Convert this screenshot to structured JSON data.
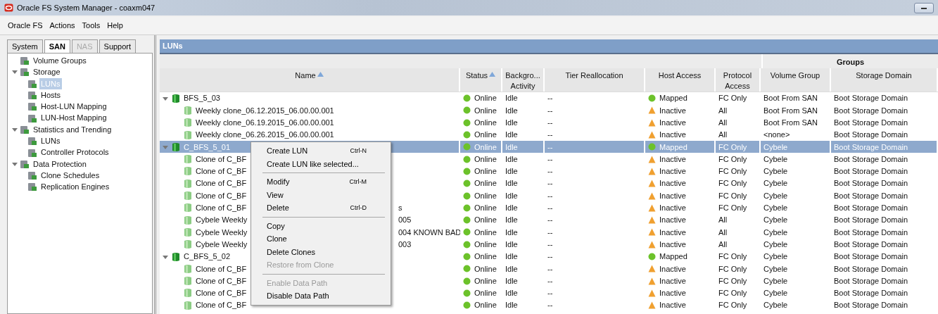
{
  "window": {
    "title": "Oracle FS System Manager - coaxm047"
  },
  "menu_bar": [
    "Oracle FS",
    "Actions",
    "Tools",
    "Help"
  ],
  "nav_tabs": [
    {
      "label": "System",
      "selected": false,
      "disabled": false
    },
    {
      "label": "SAN",
      "selected": true,
      "disabled": false
    },
    {
      "label": "NAS",
      "selected": false,
      "disabled": true
    },
    {
      "label": "Support",
      "selected": false,
      "disabled": false
    }
  ],
  "nav_tree": [
    {
      "label": "Volume Groups",
      "selected": false
    },
    {
      "label": "Storage",
      "expanded": true,
      "selected": false,
      "children": [
        {
          "label": "LUNs",
          "selected": true
        },
        {
          "label": "Hosts",
          "selected": false
        },
        {
          "label": "Host-LUN Mapping",
          "selected": false
        },
        {
          "label": "LUN-Host Mapping",
          "selected": false
        }
      ]
    },
    {
      "label": "Statistics and Trending",
      "expanded": true,
      "selected": false,
      "children": [
        {
          "label": "LUNs",
          "selected": false
        },
        {
          "label": "Controller Protocols",
          "selected": false
        }
      ]
    },
    {
      "label": "Data Protection",
      "expanded": true,
      "selected": false,
      "children": [
        {
          "label": "Clone Schedules",
          "selected": false
        },
        {
          "label": "Replication Engines",
          "selected": false
        }
      ]
    }
  ],
  "panel": {
    "title": "LUNs"
  },
  "table": {
    "group_header": "Groups",
    "columns": [
      {
        "label": "Name",
        "sorted": true
      },
      {
        "label": "Status",
        "sorted": true
      },
      {
        "label": "Backgro... Activity",
        "sorted": false
      },
      {
        "label": "Tier Reallocation",
        "sorted": false
      },
      {
        "label": "Host Access",
        "sorted": false
      },
      {
        "label": "Protocol Access",
        "sorted": false
      },
      {
        "label": "Volume Group",
        "sorted": false
      },
      {
        "label": "Storage Domain",
        "sorted": false
      }
    ],
    "rows": [
      {
        "name": "BFS_5_03",
        "expanded": true,
        "selected": false,
        "status": "Online",
        "activity": "Idle",
        "tier": "--",
        "host_access": "Mapped",
        "warning": false,
        "protocol": "FC Only",
        "volume_group": "Boot From SAN",
        "storage_domain": "Boot Storage Domain",
        "children": [
          {
            "name": "Weekly clone_06.12.2015_06.00.00.001",
            "selected": false,
            "status": "Online",
            "activity": "Idle",
            "tier": "--",
            "host_access": "Inactive",
            "warning": true,
            "protocol": "All",
            "volume_group": "Boot From SAN",
            "storage_domain": "Boot Storage Domain"
          },
          {
            "name": "Weekly clone_06.19.2015_06.00.00.001",
            "selected": false,
            "status": "Online",
            "activity": "Idle",
            "tier": "--",
            "host_access": "Inactive",
            "warning": true,
            "protocol": "All",
            "volume_group": "Boot From SAN",
            "storage_domain": "Boot Storage Domain"
          },
          {
            "name": "Weekly clone_06.26.2015_06.00.00.001",
            "selected": false,
            "status": "Online",
            "activity": "Idle",
            "tier": "--",
            "host_access": "Inactive",
            "warning": true,
            "protocol": "All",
            "volume_group": "<none>",
            "storage_domain": "Boot Storage Domain"
          }
        ]
      },
      {
        "name": "C_BFS_5_01",
        "expanded": true,
        "selected": true,
        "status": "Online",
        "activity": "Idle",
        "tier": "--",
        "host_access": "Mapped",
        "warning": false,
        "protocol": "FC Only",
        "volume_group": "Cybele",
        "storage_domain": "Boot Storage Domain",
        "children": [
          {
            "name": "Clone of C_BF",
            "selected": false,
            "status": "Online",
            "activity": "Idle",
            "tier": "--",
            "host_access": "Inactive",
            "warning": true,
            "protocol": "FC Only",
            "volume_group": "Cybele",
            "storage_domain": "Boot Storage Domain"
          },
          {
            "name": "Clone of C_BF",
            "selected": false,
            "status": "Online",
            "activity": "Idle",
            "tier": "--",
            "host_access": "Inactive",
            "warning": true,
            "protocol": "FC Only",
            "volume_group": "Cybele",
            "storage_domain": "Boot Storage Domain"
          },
          {
            "name": "Clone of C_BF",
            "selected": false,
            "status": "Online",
            "activity": "Idle",
            "tier": "--",
            "host_access": "Inactive",
            "warning": true,
            "protocol": "FC Only",
            "volume_group": "Cybele",
            "storage_domain": "Boot Storage Domain"
          },
          {
            "name": "Clone of C_BF",
            "selected": false,
            "status": "Online",
            "activity": "Idle",
            "tier": "--",
            "host_access": "Inactive",
            "warning": true,
            "protocol": "FC Only",
            "volume_group": "Cybele",
            "storage_domain": "Boot Storage Domain"
          },
          {
            "name": "Clone of C_BF",
            "name_end": "s",
            "selected": false,
            "status": "Online",
            "activity": "Idle",
            "tier": "--",
            "host_access": "Inactive",
            "warning": true,
            "protocol": "FC Only",
            "volume_group": "Cybele",
            "storage_domain": "Boot Storage Domain"
          },
          {
            "name": "Cybele Weekly",
            "name_end": "005",
            "selected": false,
            "status": "Online",
            "activity": "Idle",
            "tier": "--",
            "host_access": "Inactive",
            "warning": true,
            "protocol": "All",
            "volume_group": "Cybele",
            "storage_domain": "Boot Storage Domain"
          },
          {
            "name": "Cybele Weekly",
            "name_end": "004 KNOWN BAD",
            "selected": false,
            "status": "Online",
            "activity": "Idle",
            "tier": "--",
            "host_access": "Inactive",
            "warning": true,
            "protocol": "All",
            "volume_group": "Cybele",
            "storage_domain": "Boot Storage Domain"
          },
          {
            "name": "Cybele Weekly",
            "name_end": "003",
            "selected": false,
            "status": "Online",
            "activity": "Idle",
            "tier": "--",
            "host_access": "Inactive",
            "warning": true,
            "protocol": "All",
            "volume_group": "Cybele",
            "storage_domain": "Boot Storage Domain"
          }
        ]
      },
      {
        "name": "C_BFS_5_02",
        "expanded": true,
        "selected": false,
        "status": "Online",
        "activity": "Idle",
        "tier": "--",
        "host_access": "Mapped",
        "warning": false,
        "protocol": "FC Only",
        "volume_group": "Cybele",
        "storage_domain": "Boot Storage Domain",
        "children": [
          {
            "name": "Clone of C_BF",
            "selected": false,
            "status": "Online",
            "activity": "Idle",
            "tier": "--",
            "host_access": "Inactive",
            "warning": true,
            "protocol": "FC Only",
            "volume_group": "Cybele",
            "storage_domain": "Boot Storage Domain"
          },
          {
            "name": "Clone of C_BF",
            "selected": false,
            "status": "Online",
            "activity": "Idle",
            "tier": "--",
            "host_access": "Inactive",
            "warning": true,
            "protocol": "FC Only",
            "volume_group": "Cybele",
            "storage_domain": "Boot Storage Domain"
          },
          {
            "name": "Clone of C_BF",
            "selected": false,
            "status": "Online",
            "activity": "Idle",
            "tier": "--",
            "host_access": "Inactive",
            "warning": true,
            "protocol": "FC Only",
            "volume_group": "Cybele",
            "storage_domain": "Boot Storage Domain"
          },
          {
            "name": "Clone of C_BF",
            "selected": false,
            "status": "Online",
            "activity": "Idle",
            "tier": "--",
            "host_access": "Inactive",
            "warning": true,
            "protocol": "FC Only",
            "volume_group": "Cybele",
            "storage_domain": "Boot Storage Domain"
          }
        ]
      }
    ]
  },
  "context_menu": [
    {
      "kind": "item",
      "label": "Create LUN",
      "shortcut": "Ctrl-N",
      "disabled": false
    },
    {
      "kind": "item",
      "label": "Create LUN like selected...",
      "disabled": false
    },
    {
      "kind": "separator"
    },
    {
      "kind": "item",
      "label": "Modify",
      "shortcut": "Ctrl-M",
      "disabled": false
    },
    {
      "kind": "item",
      "label": "View",
      "disabled": false
    },
    {
      "kind": "item",
      "label": "Delete",
      "shortcut": "Ctrl-D",
      "disabled": false
    },
    {
      "kind": "separator"
    },
    {
      "kind": "item",
      "label": "Copy",
      "disabled": false
    },
    {
      "kind": "item",
      "label": "Clone",
      "disabled": false
    },
    {
      "kind": "item",
      "label": "Delete Clones",
      "disabled": false
    },
    {
      "kind": "item",
      "label": "Restore from Clone",
      "disabled": true
    },
    {
      "kind": "separator"
    },
    {
      "kind": "item",
      "label": "Enable Data Path",
      "disabled": true
    },
    {
      "kind": "item",
      "label": "Disable Data Path",
      "disabled": false
    }
  ]
}
